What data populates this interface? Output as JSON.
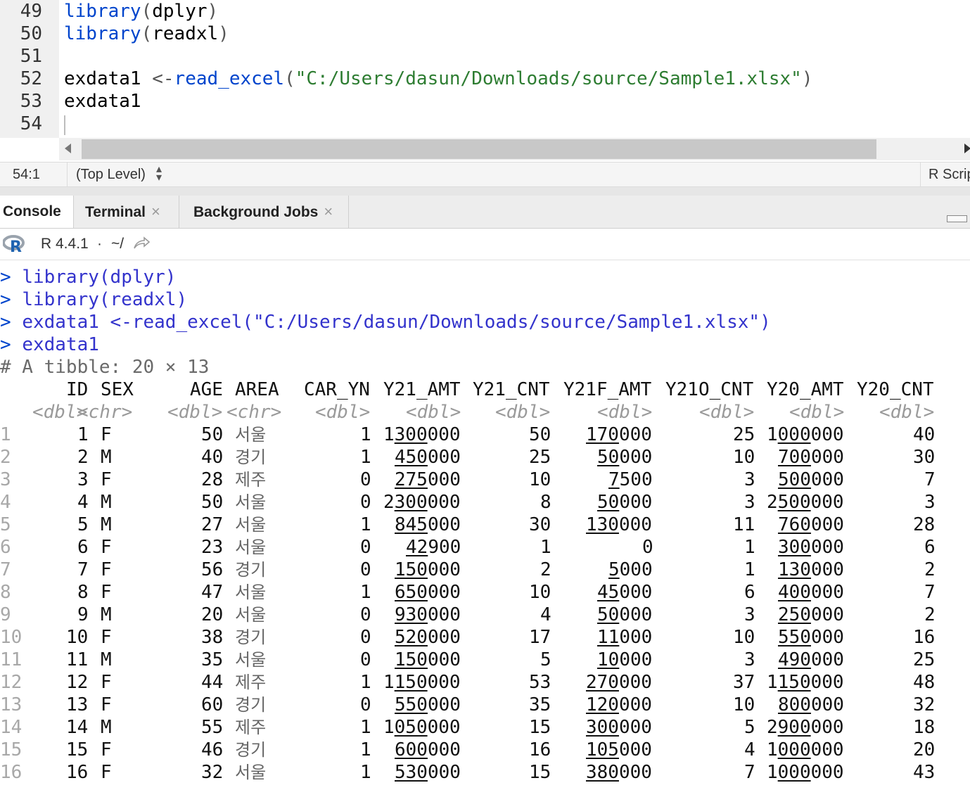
{
  "editor": {
    "line_numbers": [
      "49",
      "50",
      "51",
      "52",
      "53",
      "54"
    ],
    "lines": [
      {
        "fn": "library",
        "args": "dplyr"
      },
      {
        "fn": "library",
        "args": "readxl"
      },
      {},
      {
        "var": "exdata1",
        "assign": "<-",
        "fn": "read_excel",
        "str": "\"C:/Users/dasun/Downloads/source/Sample1.xlsx\""
      },
      {
        "var": "exdata1"
      },
      {}
    ]
  },
  "status_bar": {
    "position": "54:1",
    "scope": "(Top Level)",
    "file_type": "R Script"
  },
  "tabs": [
    {
      "label": "Console",
      "active": true,
      "closable": false
    },
    {
      "label": "Terminal",
      "active": false,
      "closable": true
    },
    {
      "label": "Background Jobs",
      "active": false,
      "closable": true
    }
  ],
  "console_header": {
    "r_version": "R 4.4.1",
    "separator": "·",
    "path": "~/"
  },
  "console": {
    "commands": [
      {
        "prompt": ">",
        "text": "library(dplyr)"
      },
      {
        "prompt": ">",
        "text": "library(readxl)"
      },
      {
        "prompt": ">",
        "text": "exdata1 <-read_excel(\"C:/Users/dasun/Downloads/source/Sample1.xlsx\")"
      },
      {
        "prompt": ">",
        "text": "exdata1"
      }
    ],
    "tibble_note": "# A tibble: 20 × 13",
    "columns": [
      "ID",
      "SEX",
      "AGE",
      "AREA",
      "CAR_YN",
      "Y21_AMT",
      "Y21_CNT",
      "Y21F_AMT",
      "Y21O_CNT",
      "Y20_AMT",
      "Y20_CNT"
    ],
    "types": [
      "<dbl>",
      "<chr>",
      "<dbl>",
      "<chr>",
      "<dbl>",
      "<dbl>",
      "<dbl>",
      "<dbl>",
      "<dbl>",
      "<dbl>",
      "<dbl>"
    ],
    "rows": [
      [
        "1",
        "1",
        "F",
        "50",
        "서울",
        "1",
        "1300000",
        "50",
        "170000",
        "25",
        "1000000",
        "40"
      ],
      [
        "2",
        "2",
        "M",
        "40",
        "경기",
        "1",
        "450000",
        "25",
        "50000",
        "10",
        "700000",
        "30"
      ],
      [
        "3",
        "3",
        "F",
        "28",
        "제주",
        "0",
        "275000",
        "10",
        "7500",
        "3",
        "500000",
        "7"
      ],
      [
        "4",
        "4",
        "M",
        "50",
        "서울",
        "0",
        "2300000",
        "8",
        "50000",
        "3",
        "2500000",
        "3"
      ],
      [
        "5",
        "5",
        "M",
        "27",
        "서울",
        "1",
        "845000",
        "30",
        "130000",
        "11",
        "760000",
        "28"
      ],
      [
        "6",
        "6",
        "F",
        "23",
        "서울",
        "0",
        "42900",
        "1",
        "0",
        "1",
        "300000",
        "6"
      ],
      [
        "7",
        "7",
        "F",
        "56",
        "경기",
        "0",
        "150000",
        "2",
        "5000",
        "1",
        "130000",
        "2"
      ],
      [
        "8",
        "8",
        "F",
        "47",
        "서울",
        "1",
        "650000",
        "10",
        "45000",
        "6",
        "400000",
        "7"
      ],
      [
        "9",
        "9",
        "M",
        "20",
        "서울",
        "0",
        "930000",
        "4",
        "50000",
        "3",
        "250000",
        "2"
      ],
      [
        "10",
        "10",
        "F",
        "38",
        "경기",
        "0",
        "520000",
        "17",
        "11000",
        "10",
        "550000",
        "16"
      ],
      [
        "11",
        "11",
        "M",
        "35",
        "서울",
        "0",
        "150000",
        "5",
        "10000",
        "3",
        "490000",
        "25"
      ],
      [
        "12",
        "12",
        "F",
        "44",
        "제주",
        "1",
        "1150000",
        "53",
        "270000",
        "37",
        "1150000",
        "48"
      ],
      [
        "13",
        "13",
        "F",
        "60",
        "경기",
        "0",
        "550000",
        "35",
        "120000",
        "10",
        "800000",
        "32"
      ],
      [
        "14",
        "14",
        "M",
        "55",
        "제주",
        "1",
        "1050000",
        "15",
        "300000",
        "5",
        "2900000",
        "18"
      ],
      [
        "15",
        "15",
        "F",
        "46",
        "경기",
        "1",
        "600000",
        "16",
        "105000",
        "4",
        "1000000",
        "20"
      ],
      [
        "16",
        "16",
        "F",
        "32",
        "서울",
        "1",
        "530000",
        "15",
        "380000",
        "7",
        "1000000",
        "43"
      ]
    ]
  }
}
